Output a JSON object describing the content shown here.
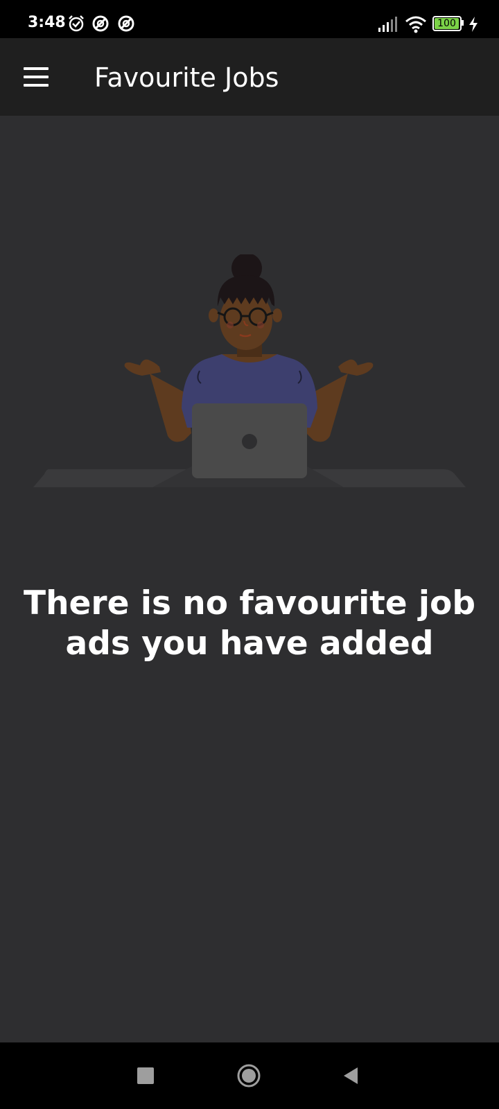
{
  "status_bar": {
    "time": "3:48",
    "battery": "100",
    "icons": [
      "alarm-icon",
      "notification-icon",
      "notification-icon",
      "signal-icon",
      "wifi-icon",
      "battery-icon",
      "charging-icon"
    ]
  },
  "app_bar": {
    "menu_icon": "hamburger-menu-icon",
    "title": "Favourite Jobs"
  },
  "empty_state": {
    "illustration": "person-shrugging-at-laptop",
    "message": "There is no favourite job ads you have added"
  },
  "nav_bar": {
    "buttons": [
      "recents-icon",
      "home-icon",
      "back-icon"
    ]
  },
  "colors": {
    "background": "#2e2e30",
    "app_bar": "#1f1f1f",
    "shirt": "#3d3f6e",
    "skin": "#5e3b1f",
    "laptop": "#4a4a4a"
  }
}
